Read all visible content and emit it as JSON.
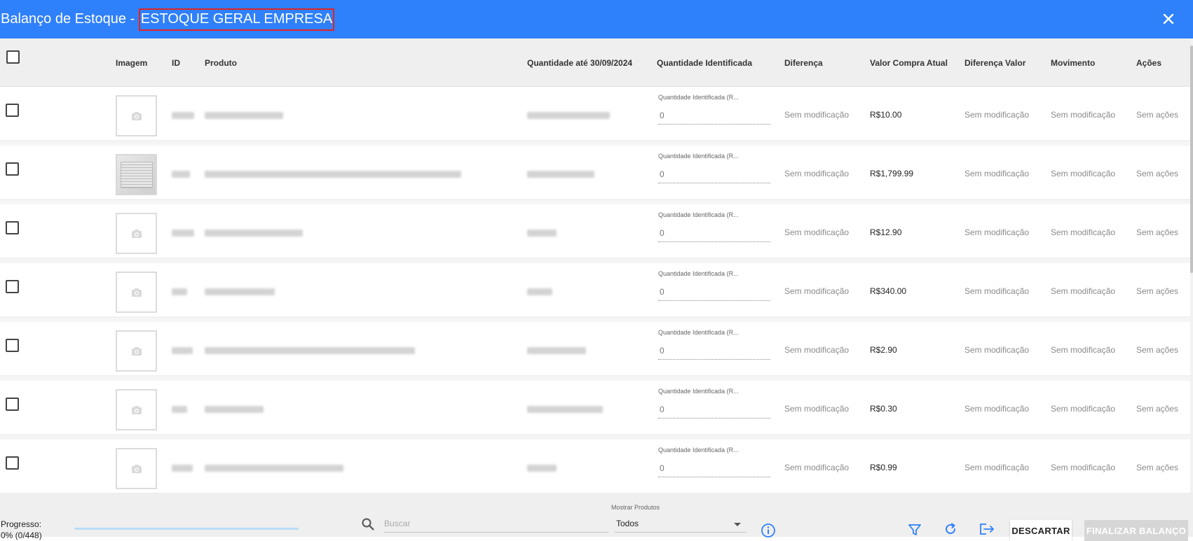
{
  "header": {
    "title_prefix": "Balanço de Estoque - ",
    "title_company": "ESTOQUE GERAL EMPRESA",
    "close_icon": "close-icon"
  },
  "columns": {
    "imagem": "Imagem",
    "id": "ID",
    "produto": "Produto",
    "quantidade_ate": "Quantidade até 30/09/2024",
    "quantidade_identificada": "Quantidade Identificada",
    "diferenca": "Diferença",
    "valor_compra": "Valor Compra Atual",
    "diferenca_valor": "Diferença Valor",
    "movimento": "Movimento",
    "acoes": "Ações"
  },
  "rows": [
    {
      "image": "placeholder",
      "qty_label": "Quantidade Identificada (R...",
      "qty_value": "0",
      "diferenca": "Sem modificação",
      "valor": "R$10.00",
      "diferenca_valor": "Sem modificação",
      "movimento": "Sem modificação",
      "acoes": "Sem ações"
    },
    {
      "image": "photo",
      "qty_label": "Quantidade Identificada (R...",
      "qty_value": "0",
      "diferenca": "Sem modificação",
      "valor": "R$1,799.99",
      "diferenca_valor": "Sem modificação",
      "movimento": "Sem modificação",
      "acoes": "Sem ações"
    },
    {
      "image": "placeholder",
      "qty_label": "Quantidade Identificada (R...",
      "qty_value": "0",
      "diferenca": "Sem modificação",
      "valor": "R$12.90",
      "diferenca_valor": "Sem modificação",
      "movimento": "Sem modificação",
      "acoes": "Sem ações"
    },
    {
      "image": "placeholder",
      "qty_label": "Quantidade Identificada (R...",
      "qty_value": "0",
      "diferenca": "Sem modificação",
      "valor": "R$340.00",
      "diferenca_valor": "Sem modificação",
      "movimento": "Sem modificação",
      "acoes": "Sem ações"
    },
    {
      "image": "placeholder",
      "qty_label": "Quantidade Identificada (R...",
      "qty_value": "0",
      "diferenca": "Sem modificação",
      "valor": "R$2.90",
      "diferenca_valor": "Sem modificação",
      "movimento": "Sem modificação",
      "acoes": "Sem ações"
    },
    {
      "image": "placeholder",
      "qty_label": "Quantidade Identificada (R...",
      "qty_value": "0",
      "diferenca": "Sem modificação",
      "valor": "R$0.30",
      "diferenca_valor": "Sem modificação",
      "movimento": "Sem modificação",
      "acoes": "Sem ações"
    },
    {
      "image": "placeholder",
      "qty_label": "Quantidade Identificada (R...",
      "qty_value": "0",
      "diferenca": "Sem modificação",
      "valor": "R$0.99",
      "diferenca_valor": "Sem modificação",
      "movimento": "Sem modificação",
      "acoes": "Sem ações"
    }
  ],
  "footer": {
    "progress_label": "Progresso:",
    "progress_count": "0% (0/448)",
    "progress_fraction": 0,
    "search_placeholder": "Buscar",
    "show_products_label": "Mostrar Produtos",
    "show_products_value": "Todos",
    "discard_label": "DESCARTAR",
    "finish_label": "FINALIZAR BALANÇO"
  },
  "colors": {
    "accent": "#2f80fb",
    "title_highlight_border": "#e02424"
  }
}
